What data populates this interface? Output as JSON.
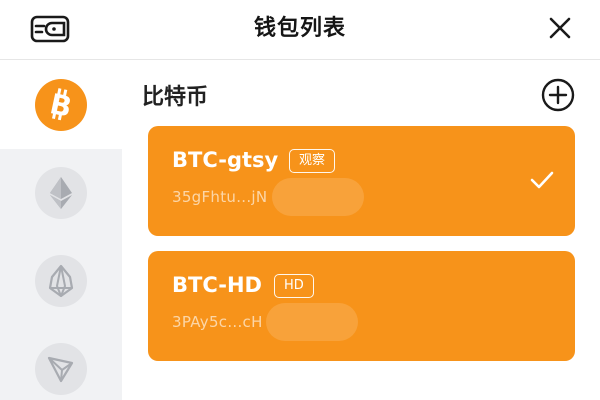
{
  "header": {
    "title": "钱包列表",
    "left_icon": "wallet-icon",
    "right_icon": "close-icon"
  },
  "sidebar": {
    "chains": [
      {
        "icon": "bitcoin-icon",
        "active": true
      },
      {
        "icon": "ethereum-icon",
        "active": false
      },
      {
        "icon": "eos-icon",
        "active": false
      },
      {
        "icon": "tron-icon",
        "active": false
      }
    ]
  },
  "main": {
    "section_title": "比特币",
    "add_icon": "add-circle-icon",
    "wallets": [
      {
        "name": "BTC-gtsy",
        "tag": "观察",
        "address": "35gFhtu...jN",
        "selected": true
      },
      {
        "name": "BTC-HD",
        "tag": "HD",
        "address": "3PAy5c...cH",
        "selected": false
      }
    ]
  },
  "colors": {
    "accent": "#f7931a",
    "sidebar_bg": "#f1f2f4",
    "inactive_icon_bg": "#e2e3e6",
    "inactive_icon_fg": "#a8abb1"
  }
}
